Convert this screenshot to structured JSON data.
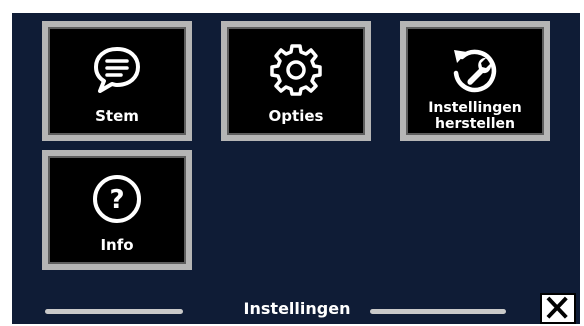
{
  "tiles": {
    "stem": {
      "label": "Stem",
      "icon": "speech-bubble-icon"
    },
    "opties": {
      "label": "Opties",
      "icon": "gear-icon"
    },
    "reset": {
      "label": "Instellingen\nherstellen",
      "icon": "reset-wrench-icon"
    },
    "info": {
      "label": "Info",
      "icon": "question-mark-icon"
    }
  },
  "footer": {
    "title": "Instellingen",
    "close_icon": "close-icon"
  },
  "colors": {
    "background": "#0f1c36",
    "tile_frame": "#b5b5b5",
    "tile_face": "#000000",
    "text": "#ffffff"
  }
}
